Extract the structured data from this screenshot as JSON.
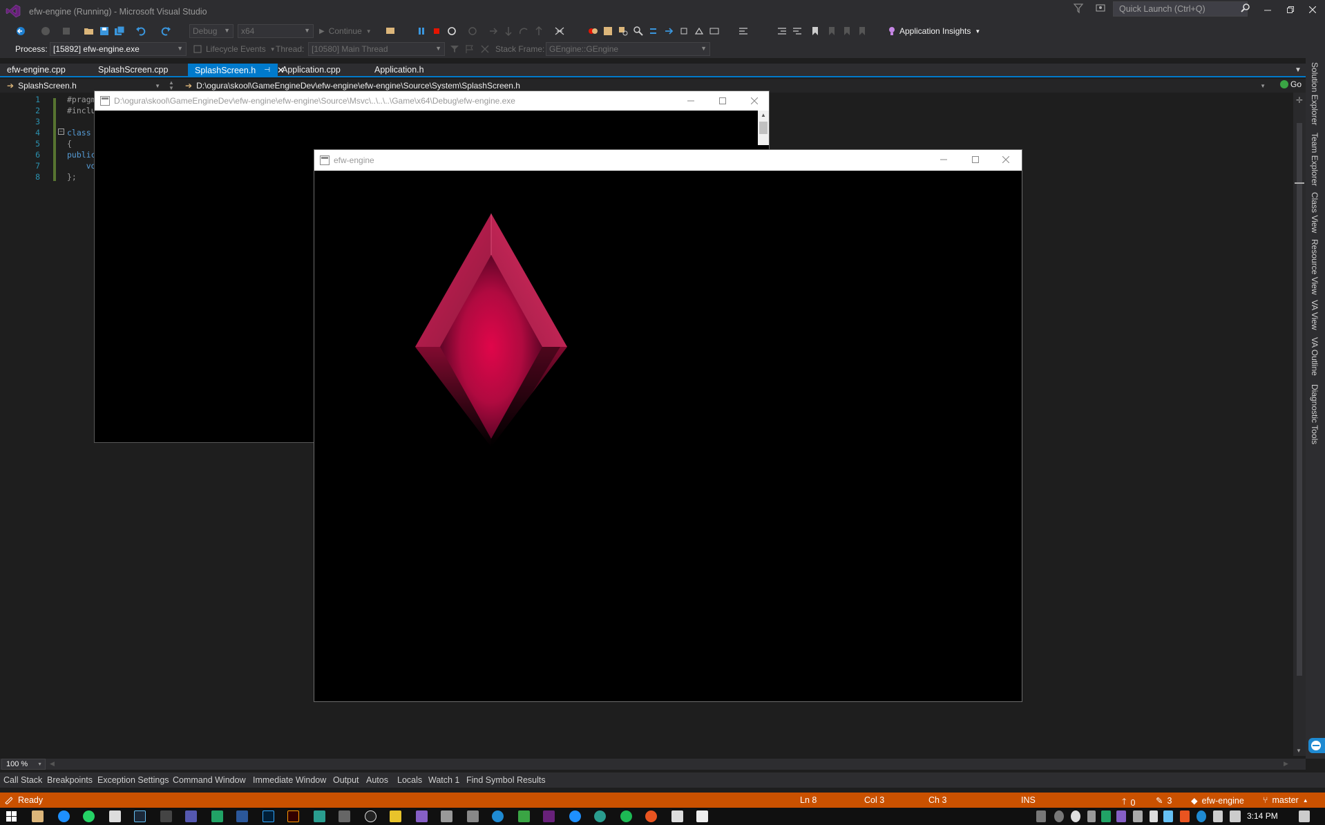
{
  "window": {
    "title": "efw-engine (Running) - Microsoft Visual Studio",
    "quick_launch_placeholder": "Quick Launch (Ctrl+Q)"
  },
  "toolbar": {
    "config": "Debug",
    "platform": "x64",
    "continue_label": "Continue",
    "app_insights_label": "Application Insights",
    "process_label": "Process:",
    "process_value": "[15892] efw-engine.exe",
    "lifecycle_label": "Lifecycle Events",
    "thread_label": "Thread:",
    "thread_value": "[10580] Main Thread",
    "stackframe_label": "Stack Frame:",
    "stackframe_value": "GEngine::GEngine"
  },
  "tabs": [
    {
      "label": "efw-engine.cpp",
      "active": false
    },
    {
      "label": "SplashScreen.cpp",
      "active": false
    },
    {
      "label": "SplashScreen.h",
      "active": true
    },
    {
      "label": "Application.cpp",
      "active": false
    },
    {
      "label": "Application.h",
      "active": false
    }
  ],
  "navbar": {
    "scope": "SplashScreen.h",
    "path": "D:\\ogura\\skool\\GameEngineDev\\efw-engine\\efw-engine\\Source\\System\\SplashScreen.h",
    "go_label": "Go"
  },
  "editor": {
    "line_numbers": [
      "1",
      "2",
      "3",
      "4",
      "5",
      "6",
      "7",
      "8"
    ],
    "lines": [
      "#pragm",
      "#inclu",
      "",
      "class",
      "{",
      "public",
      "    vo",
      "};"
    ],
    "zoom": "100 %"
  },
  "side_tabs": [
    "Solution Explorer",
    "Team Explorer",
    "Class View",
    "Resource View",
    "VA View",
    "VA Outline",
    "Diagnostic Tools"
  ],
  "tool_windows": [
    "Call Stack",
    "Breakpoints",
    "Exception Settings",
    "Command Window",
    "Immediate Window",
    "Output",
    "Autos",
    "Locals",
    "Watch 1",
    "Find Symbol Results"
  ],
  "status": {
    "ready": "Ready",
    "ln": "Ln 8",
    "col": "Col 3",
    "ch": "Ch 3",
    "ins": "INS",
    "up_count": "0",
    "pencil_count": "3",
    "repo": "efw-engine",
    "branch": "master"
  },
  "console_window": {
    "title": "D:\\ogura\\skool\\GameEngineDev\\efw-engine\\efw-engine\\Source\\Msvc\\..\\..\\..\\Game\\x64\\Debug\\efw-engine.exe"
  },
  "game_window": {
    "title": "efw-engine"
  },
  "taskbar": {
    "clock": "3:14 PM"
  },
  "colors": {
    "accent": "#007acc",
    "status_bar": "#ca5100",
    "gem": "#e0064a"
  }
}
